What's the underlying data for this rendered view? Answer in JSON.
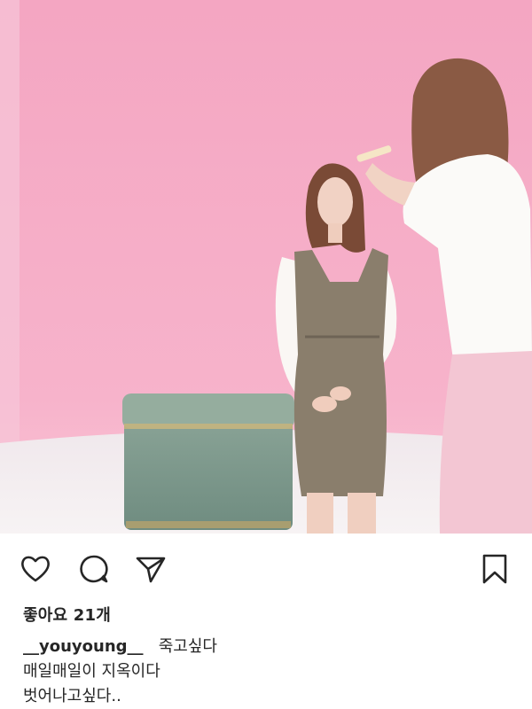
{
  "post": {
    "photo_description_icon": "photo",
    "likes_text": "좋아요 21개",
    "username": "__youyoung__",
    "caption_lines": [
      "죽고싶다",
      "매일매일이 지옥이다",
      "벗어나고싶다.."
    ]
  },
  "actions": {
    "like_icon": "heart-icon",
    "comment_icon": "comment-icon",
    "share_icon": "send-icon",
    "save_icon": "bookmark-icon"
  },
  "colors": {
    "backdrop_pink": "#f5a9c4",
    "floor": "#f3eef0",
    "text": "#262626"
  }
}
